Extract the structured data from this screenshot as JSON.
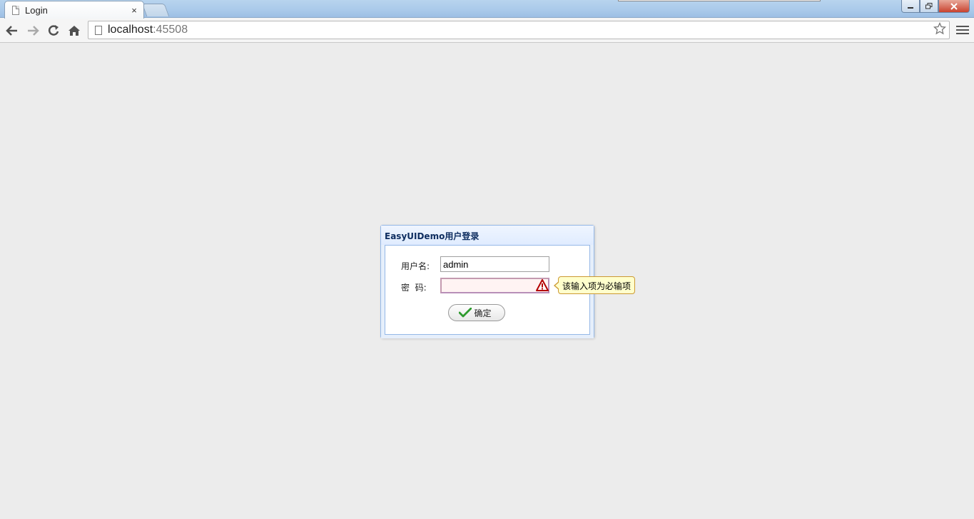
{
  "browser": {
    "tab_title": "Login",
    "tab_close": "×",
    "url_host": "localhost",
    "url_port": ":45508"
  },
  "login": {
    "panel_title": "EasyUIDemo用户登录",
    "username_label": "用户名:",
    "username_value": "admin",
    "password_label": "密  码:",
    "password_value": "",
    "validation_message": "该输入项为必输项",
    "submit_label": "确定"
  },
  "colors": {
    "panel_border": "#95b8e7",
    "panel_title": "#0e2d5f",
    "tooltip_bg": "#ffffcc",
    "invalid_bg": "#fff3f3",
    "warning": "#b40000",
    "check": "#2e9a2e"
  },
  "icons": {
    "tab": "page-icon",
    "back": "arrow-left-icon",
    "forward": "arrow-right-icon",
    "reload": "reload-icon",
    "home": "home-icon",
    "bookmark": "star-icon",
    "menu": "hamburger-menu-icon",
    "warning": "warning-triangle-icon",
    "submit": "checkmark-icon"
  }
}
